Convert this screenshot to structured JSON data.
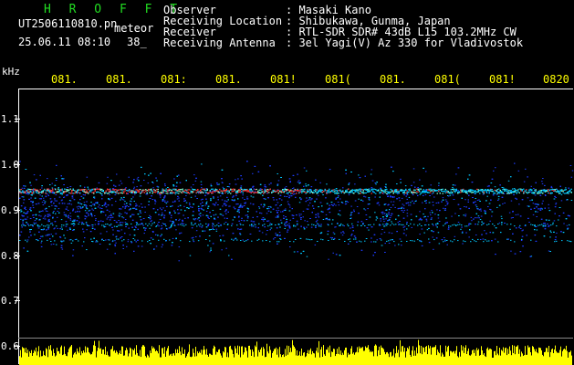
{
  "app": {
    "title": "H R O F F T",
    "filename": "UT2506110810.pn",
    "tag": "meteor",
    "date": "25.06.11 08:10",
    "count": "38_"
  },
  "info": {
    "rows": [
      {
        "label": "Observer",
        "value": ": Masaki Kano"
      },
      {
        "label": "Receiving Location",
        "value": ": Shibukawa, Gunma, Japan"
      },
      {
        "label": "Receiver",
        "value": ": RTL-SDR SDR# 43dB L15 103.2MHz CW"
      },
      {
        "label": "Receiving Antenna",
        "value": ": 3el Yagi(V) Az 330 for Vladivostok"
      }
    ]
  },
  "axis": {
    "y_unit": "kHz",
    "y_labels": [
      "1.1",
      "1.0",
      "0.9",
      "0.8",
      "0.7",
      "0.6"
    ],
    "x_labels": [
      "081.",
      "081.",
      "081:",
      "081.",
      "081!",
      "081(",
      "081.",
      "081(",
      "081!",
      "0820"
    ]
  },
  "colors": {
    "background": "#000000",
    "text": "#ffffff",
    "title": "#22dd22",
    "ticks": "#ffff00",
    "signal_low": "#1e3cff",
    "signal_mid": "#00c8ff",
    "signal_high": "#ff3030",
    "amplitude": "#ffff00"
  }
}
